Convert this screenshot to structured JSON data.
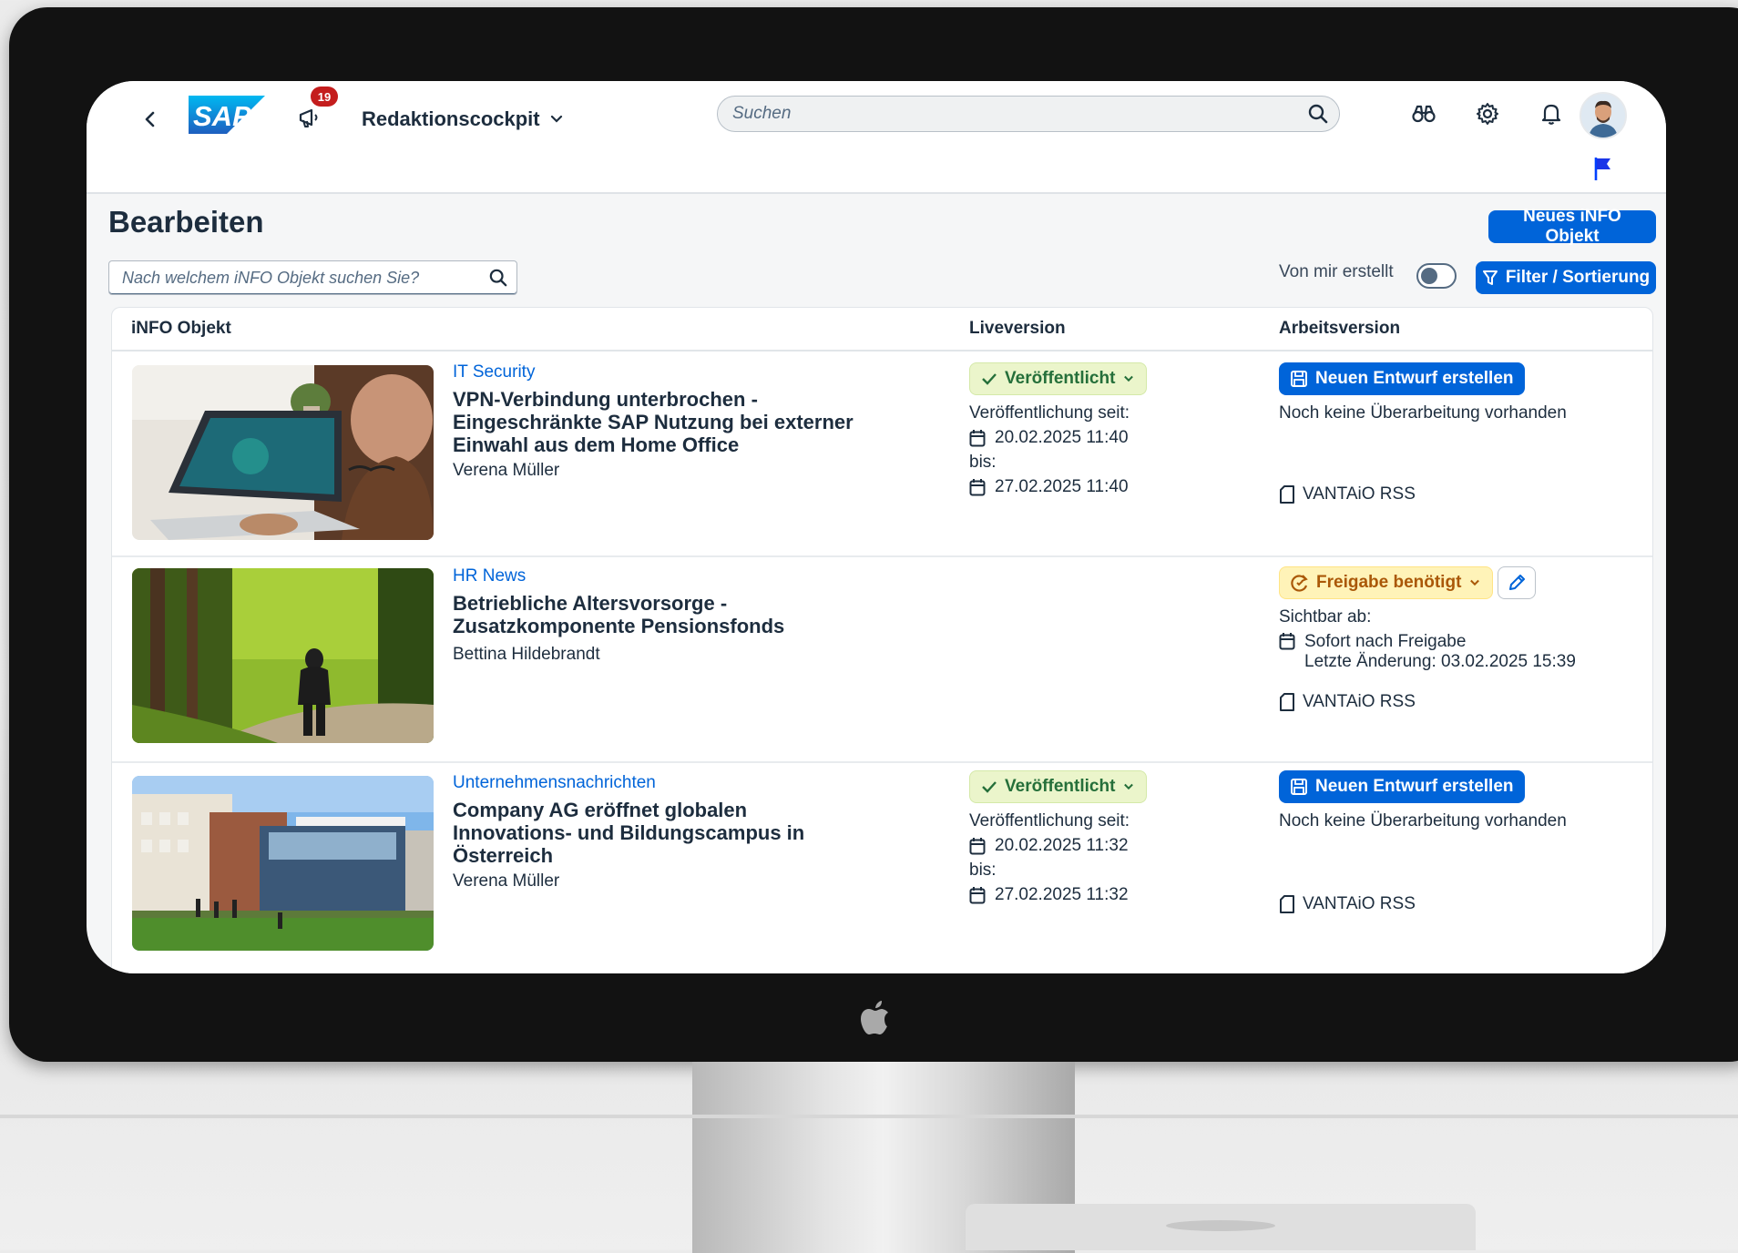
{
  "shell": {
    "notification_count": "19",
    "app_title": "Redaktionscockpit",
    "search_placeholder": "Suchen"
  },
  "page": {
    "title": "Bearbeiten",
    "new_button": "Neues iNFO Objekt",
    "list_search_placeholder": "Nach welchem iNFO Objekt suchen Sie?",
    "toggle_label": "Von mir erstellt",
    "filter_button": "Filter / Sortierung"
  },
  "table": {
    "columns": [
      "iNFO Objekt",
      "Liveversion",
      "Arbeitsversion"
    ],
    "rows": [
      {
        "category": "IT Security",
        "title": "VPN-Verbindung unterbrochen - Eingeschränkte SAP Nutzung bei externer Einwahl aus dem Home Office",
        "author": "Verena Müller",
        "live_status": "Veröffentlicht",
        "published_since_label": "Veröffentlichung seit:",
        "published_since": "20.02.2025 11:40",
        "until_label": "bis:",
        "until": "27.02.2025 11:40",
        "work_button": "Neuen Entwurf erstellen",
        "work_text": "Noch keine Überarbeitung vorhanden",
        "channel": "VANTAiO RSS"
      },
      {
        "category": "HR News",
        "title": "Betriebliche Altersvorsorge - Zusatzkomponente Pensionsfonds",
        "author": "Bettina Hildebrandt",
        "work_status": "Freigabe benötigt",
        "visible_label": "Sichtbar ab:",
        "visible_value": "Sofort nach Freigabe",
        "last_change": "Letzte Änderung: 03.02.2025 15:39",
        "channel": "VANTAiO RSS"
      },
      {
        "category": "Unternehmensnachrichten",
        "title": "Company AG eröffnet globalen Innovations- und Bildungscampus in Österreich",
        "author": "Verena Müller",
        "live_status": "Veröffentlicht",
        "published_since_label": "Veröffentlichung seit:",
        "published_since": "20.02.2025 11:32",
        "until_label": "bis:",
        "until": "27.02.2025 11:32",
        "work_button": "Neuen Entwurf erstellen",
        "work_text": "Noch keine Überarbeitung vorhanden",
        "channel": "VANTAiO RSS"
      }
    ]
  },
  "icons": {
    "back": "chevron-left-icon",
    "announce": "megaphone-icon",
    "search": "search-icon",
    "binoculars": "binoculars-icon",
    "settings": "gear-icon",
    "bell": "bell-icon",
    "flag": "flag-icon",
    "calendar": "calendar-icon",
    "document": "document-icon",
    "edit": "pencil-icon",
    "filter": "filter-icon",
    "draft": "save-icon"
  },
  "colors": {
    "accent": "#0064d9",
    "positive_bg": "#ebf5cb",
    "positive_text": "#256f3a",
    "critical_bg": "#fff3b8",
    "critical_text": "#aa5808",
    "badge": "#c41d1d"
  }
}
